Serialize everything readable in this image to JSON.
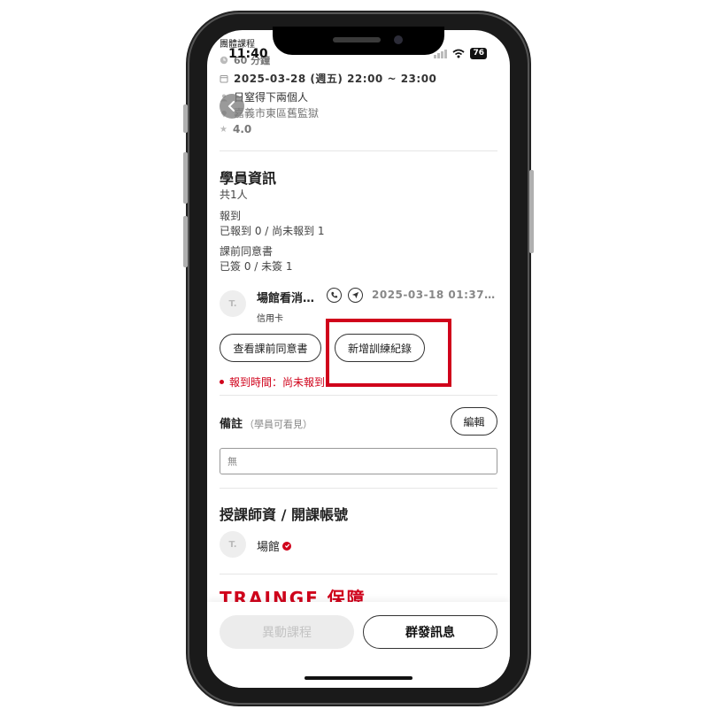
{
  "status_bar": {
    "page_label": "團體課程",
    "time": "11:40",
    "battery": "76"
  },
  "course": {
    "subtitle_fragment": "60 分鐘",
    "datetime": "2025-03-28 (週五) 22:00 ~ 23:00",
    "organizer": "日窒得下兩個人",
    "location": "嘉義市東區舊監獄",
    "rating": "4.0"
  },
  "students": {
    "title": "學員資訊",
    "count": "共1人",
    "checkin_label": "報到",
    "checkin_values": "已報到 0 / 尚未報到 1",
    "consent_label": "課前同意書",
    "consent_values": "已簽 0 / 未簽 1",
    "member": {
      "avatar": "T.",
      "name": "場館看消…",
      "time": "2025-03-18 01:37…",
      "payment": "信用卡"
    },
    "view_consent_label": "查看課前同意書",
    "add_record_label": "新增訓練紀錄",
    "checkin_time_warning": "報到時間：尚未報到"
  },
  "notes": {
    "label": "備註",
    "sublabel": "（學員可看見）",
    "edit_label": "編輯",
    "value": "無"
  },
  "instructor": {
    "title": "授課師資 / 開課帳號",
    "avatar": "T.",
    "name": "場館"
  },
  "brand_text": "TRAINGE 保障",
  "bottom": {
    "change_label": "異動課程",
    "broadcast_label": "群發訊息"
  },
  "colors": {
    "accent": "#d0021b",
    "highlight": "#d0021b"
  }
}
